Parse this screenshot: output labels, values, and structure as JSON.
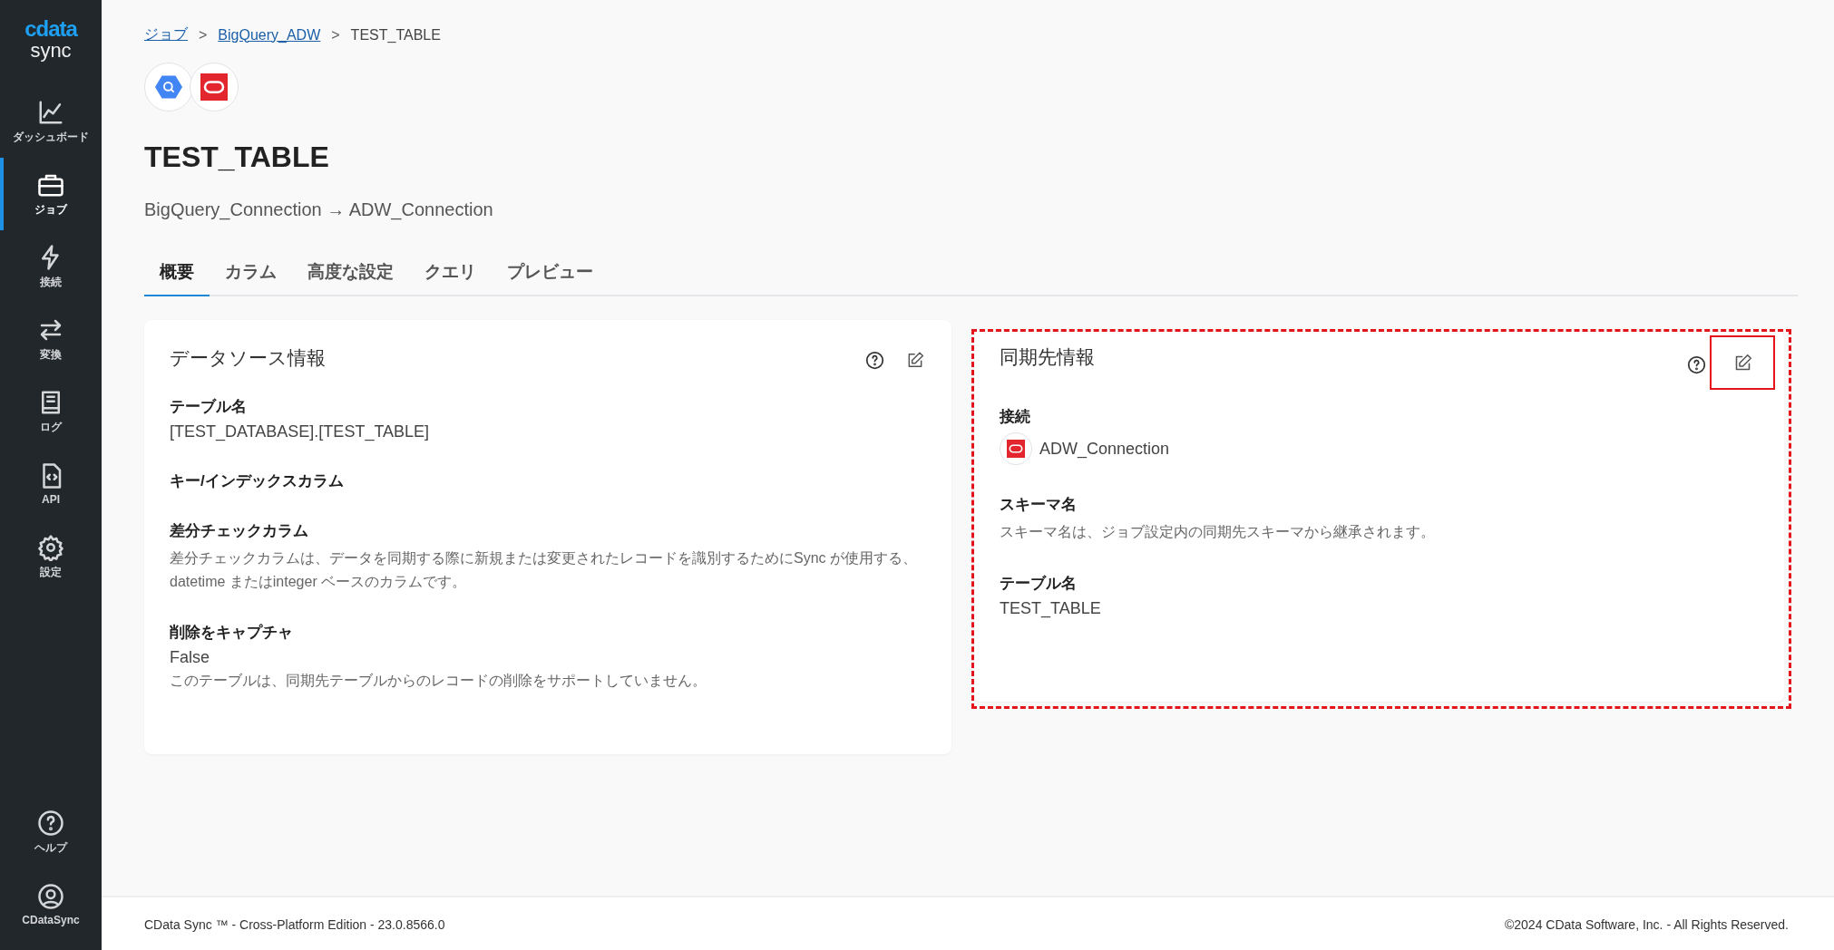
{
  "sidebar": {
    "logo": {
      "brand": "cdata",
      "product": "sync"
    },
    "items": [
      {
        "label": "ダッシュボード",
        "selected": false
      },
      {
        "label": "ジョブ",
        "selected": true
      },
      {
        "label": "接続",
        "selected": false
      },
      {
        "label": "変換",
        "selected": false
      },
      {
        "label": "ログ",
        "selected": false
      },
      {
        "label": "API",
        "selected": false
      },
      {
        "label": "設定",
        "selected": false
      }
    ],
    "bottom_items": [
      {
        "label": "ヘルプ"
      },
      {
        "label": "CDataSync"
      }
    ]
  },
  "breadcrumb": [
    {
      "label": "ジョブ",
      "link": true
    },
    {
      "label": "BigQuery_ADW",
      "link": true
    },
    {
      "label": "TEST_TABLE",
      "link": false
    }
  ],
  "separator": ">",
  "title": "TEST_TABLE",
  "subtitle": "BigQuery_Connection → ADW_Connection",
  "tabs": [
    {
      "label": "概要",
      "selected": true
    },
    {
      "label": "カラム",
      "selected": false
    },
    {
      "label": "高度な設定",
      "selected": false
    },
    {
      "label": "クエリ",
      "selected": false
    },
    {
      "label": "プレビュー",
      "selected": false
    }
  ],
  "cards": [
    {
      "title": "データソース情報",
      "highlighted": false,
      "edit_highlighted": false,
      "fields": [
        {
          "label": "テーブル名",
          "value": "[TEST_DATABASE].[TEST_TABLE]"
        },
        {
          "label": "キー/インデックスカラム"
        },
        {
          "label": "差分チェックカラム",
          "note": "差分チェックカラムは、データを同期する際に新規または変更されたレコードを識別するためにSync が使用する、datetime またはinteger ベースのカラムです。"
        },
        {
          "label": "削除をキャプチャ",
          "value": "False",
          "note": "このテーブルは、同期先テーブルからのレコードの削除をサポートしていません。"
        }
      ]
    },
    {
      "title": "同期先情報",
      "highlighted": true,
      "edit_highlighted": true,
      "fields": [
        {
          "label": "接続",
          "connection": "ADW_Connection"
        },
        {
          "label": "スキーマ名",
          "note": "スキーマ名は、ジョブ設定内の同期先スキーマから継承されます。"
        },
        {
          "label": "テーブル名",
          "value": "TEST_TABLE"
        }
      ]
    }
  ],
  "footer": {
    "left": "CData Sync ™ - Cross-Platform Edition - 23.0.8566.0",
    "right": "©2024 CData Software, Inc. - All Rights Reserved."
  }
}
